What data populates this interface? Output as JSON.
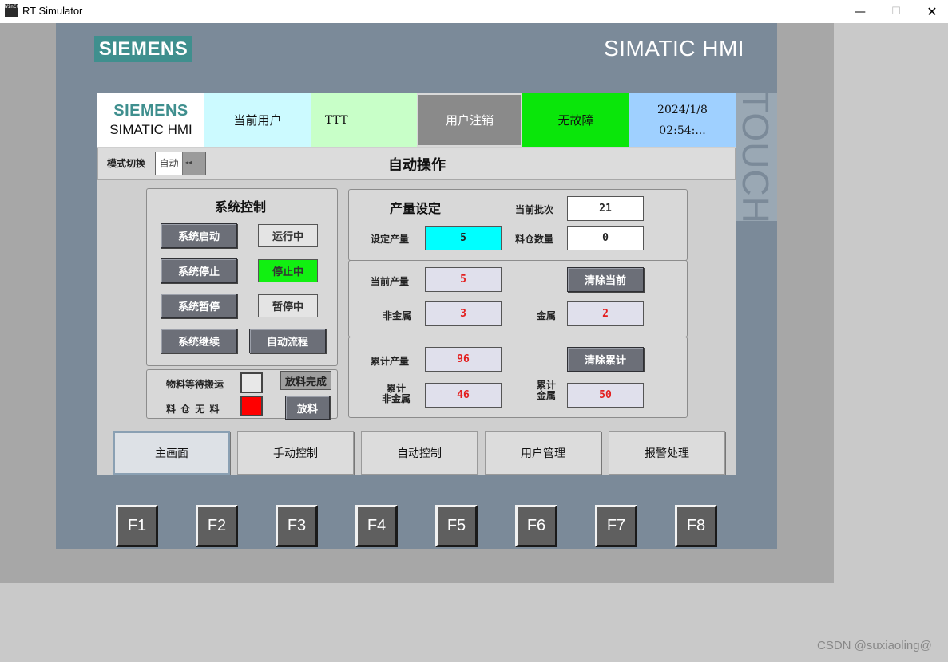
{
  "window": {
    "app_icon": "WinCC",
    "title": "RT Simulator",
    "min_glyph": "—",
    "max_glyph": "☐",
    "close_glyph": "✕"
  },
  "device": {
    "logo": "SIEMENS",
    "brand": "SIMATIC HMI",
    "touch": "TOUCH"
  },
  "header": {
    "logo_line1": "SIEMENS",
    "logo_line2": "SIMATIC HMI",
    "user_label": "当前用户",
    "user_value": "TTT",
    "logout": "用户注销",
    "fault_status": "无故障",
    "date": "2024/1/8",
    "time": "02:54:..."
  },
  "mode": {
    "label": "模式切换",
    "switch_value": "自动",
    "switch_arrows": "◂◂",
    "page_title": "自动操作"
  },
  "system_control": {
    "title": "系统控制",
    "buttons": {
      "start": "系统启动",
      "stop": "系统停止",
      "pause": "系统暂停",
      "resume": "系统继续",
      "auto_flow": "自动流程"
    },
    "status": {
      "running": "运行中",
      "stopped": "停止中",
      "paused": "暂停中"
    }
  },
  "material": {
    "waiting_label": "物料等待搬运",
    "empty_label": "料 仓 无 料",
    "release_done": "放料完成",
    "release": "放料"
  },
  "production": {
    "title": "产量设定",
    "set_label": "设定产量",
    "set_value": "5",
    "batch_label": "当前批次",
    "batch_value": "21",
    "bin_label": "料仓数量",
    "bin_value": "0",
    "current_label": "当前产量",
    "current_value": "5",
    "clear_current": "清除当前",
    "nonmetal_label": "非金属",
    "nonmetal_value": "3",
    "metal_label": "金属",
    "metal_value": "2",
    "total_label": "累计产量",
    "total_value": "96",
    "clear_total": "清除累计",
    "total_nonmetal_l1": "累计",
    "total_nonmetal_l2": "非金属",
    "total_nonmetal_value": "46",
    "total_metal_l1": "累计",
    "total_metal_l2": "金属",
    "total_metal_value": "50"
  },
  "nav": [
    "主画面",
    "手动控制",
    "自动控制",
    "用户管理",
    "报警处理"
  ],
  "fkeys": [
    "F1",
    "F2",
    "F3",
    "F4",
    "F5",
    "F6",
    "F7",
    "F8"
  ],
  "watermark": "CSDN @suxiaoling@",
  "colors": {
    "siemens_teal": "#3f8f8e",
    "fault_ok": "#0ae60a",
    "stopped_status": "#11f011",
    "bin_empty_alarm": "#ff0000",
    "set_value_field": "#00ffff"
  }
}
